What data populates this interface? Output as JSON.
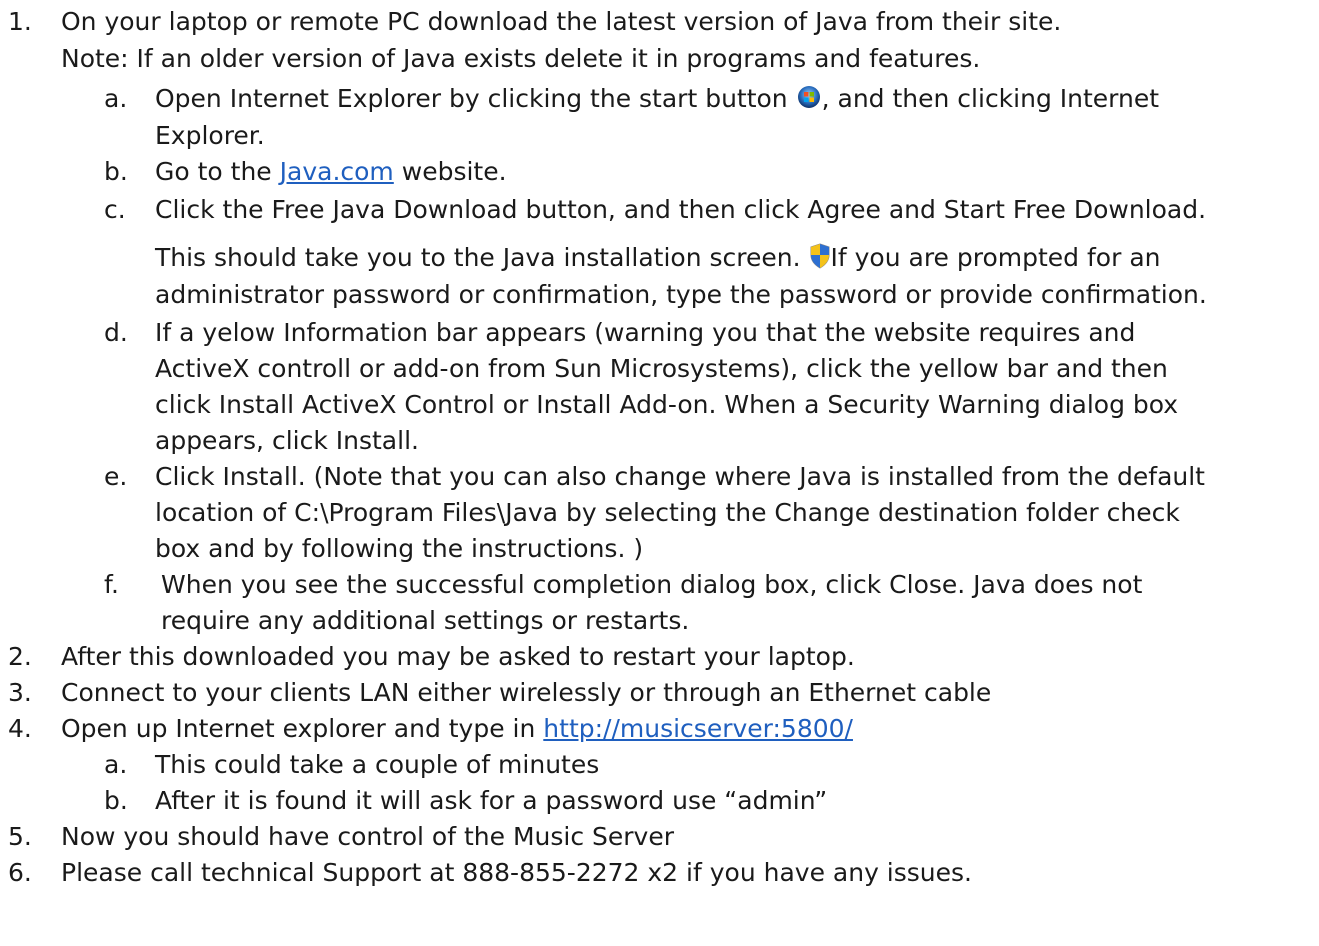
{
  "colors": {
    "text": "#1a1a1a",
    "link": "#1f5fbf"
  },
  "steps": [
    {
      "marker": "1.",
      "text": "On your laptop or remote PC download the latest version of Java from their site.",
      "note": "Note: If an older version of Java exists delete it in programs and features.",
      "substeps": [
        {
          "marker": "a.",
          "text_before_icon": "Open Internet Explorer by clicking the start button",
          "text_after_icon": ", and then clicking Internet",
          "text_cont": "Explorer.",
          "icon": "windows-start-orb-icon"
        },
        {
          "marker": "b.",
          "text_before_link": "Go to the",
          "link_text": "Java.com",
          "text_after_link": "website."
        },
        {
          "marker": "c.",
          "text": "Click the Free Java Download button, and then click Agree and Start Free Download.",
          "para_line1": "This should take you to the Java installation screen.",
          "para_line1_after_icon": "If you are prompted for an",
          "para_line2": "administrator password or confirmation, type the password or provide confirmation.",
          "icon": "uac-shield-icon"
        },
        {
          "marker": "d.",
          "lines": [
            "If a yelow Information bar appears (warning you that the website requires and",
            "ActiveX controll or add-on from Sun Microsystems), click the yellow bar and then",
            "click Install ActiveX Control or Install Add-on. When a Security Warning dialog box",
            "appears, click Install."
          ]
        },
        {
          "marker": "e.",
          "lines": [
            "Click Install. (Note that you can also change where Java is installed from the default",
            "location of C:\\Program Files\\Java by selecting the Change destination folder check",
            "box and by following the instructions. )"
          ]
        },
        {
          "marker": "f.",
          "lines": [
            "When you see the successful completion dialog box, click Close. Java does not",
            "require any additional settings or restarts."
          ]
        }
      ]
    },
    {
      "marker": "2.",
      "text": "After this downloaded you may be asked to restart your laptop."
    },
    {
      "marker": "3.",
      "text": "Connect to your clients LAN either wirelessly or through an Ethernet cable"
    },
    {
      "marker": "4.",
      "text_before_link": "Open up Internet explorer and type in",
      "link_text": "http://musicserver:5800/",
      "substeps": [
        {
          "marker": "a.",
          "text": "This could take a couple of minutes"
        },
        {
          "marker": "b.",
          "text": "After it is found it will ask for a password use “admin”"
        }
      ]
    },
    {
      "marker": "5.",
      "text": "Now you should have control of the Music Server"
    },
    {
      "marker": "6.",
      "text": "Please call technical Support at 888-855-2272 x2 if you have any issues."
    }
  ]
}
